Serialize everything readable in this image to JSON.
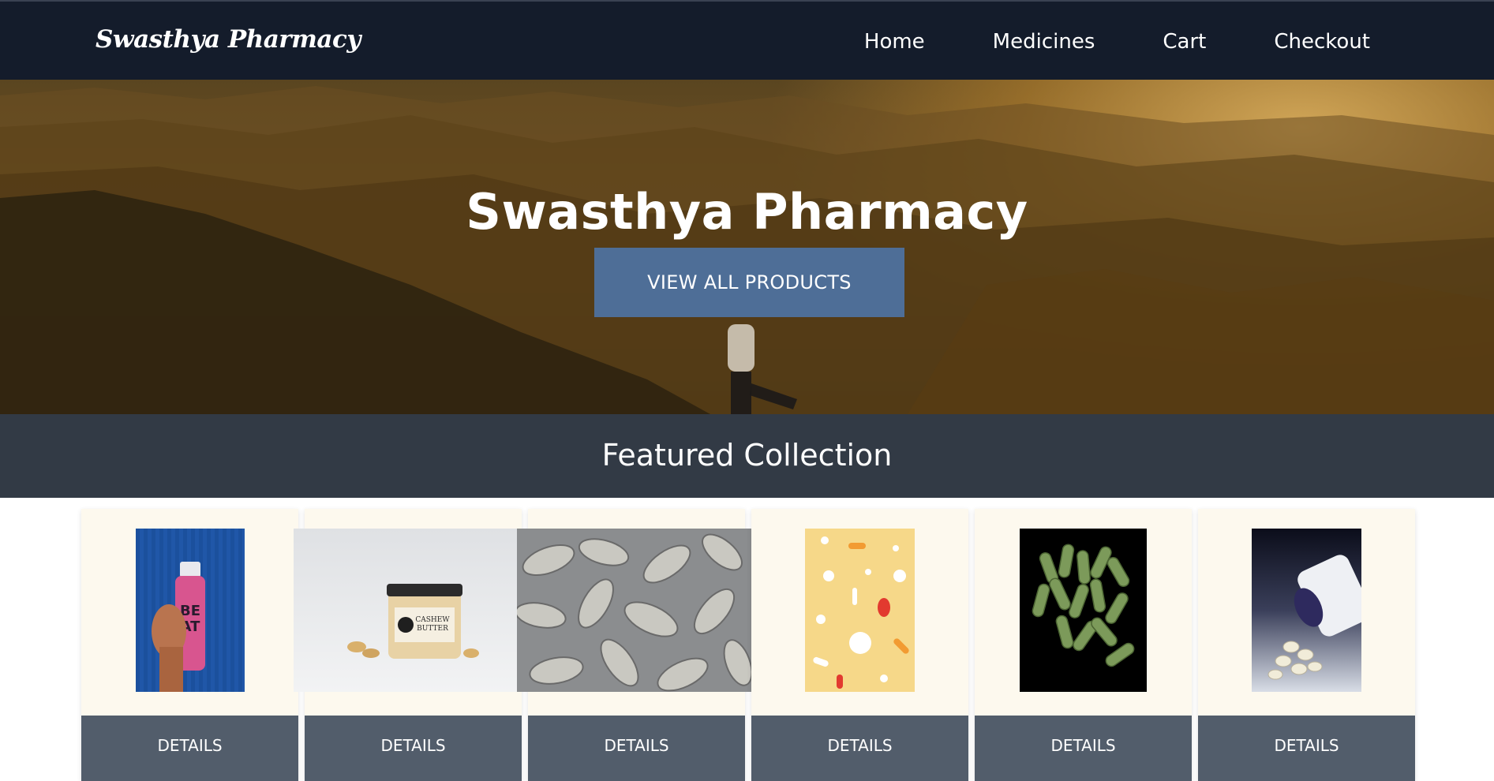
{
  "navbar": {
    "brand": "Swasthya Pharmacy",
    "links": [
      "Home",
      "Medicines",
      "Cart",
      "Checkout"
    ]
  },
  "hero": {
    "title": "Swasthya Pharmacy",
    "button_label": "VIEW ALL PRODUCTS"
  },
  "featured": {
    "title": "Featured Collection"
  },
  "products": [
    {
      "image": "protein-drink-bottle-image",
      "details_label": "DETAILS"
    },
    {
      "image": "cashew-butter-jar-image",
      "details_label": "DETAILS"
    },
    {
      "image": "white-tablets-image",
      "details_label": "DETAILS"
    },
    {
      "image": "colorful-pills-image",
      "details_label": "DETAILS"
    },
    {
      "image": "green-capsules-image",
      "details_label": "DETAILS"
    },
    {
      "image": "pill-bottle-image",
      "details_label": "DETAILS"
    }
  ],
  "colors": {
    "navbar": "#141c2b",
    "accent_button": "#4e6e97",
    "featured_bar": "#323a45",
    "details_button": "#525d6b",
    "card_bg": "#fdf9ee"
  }
}
